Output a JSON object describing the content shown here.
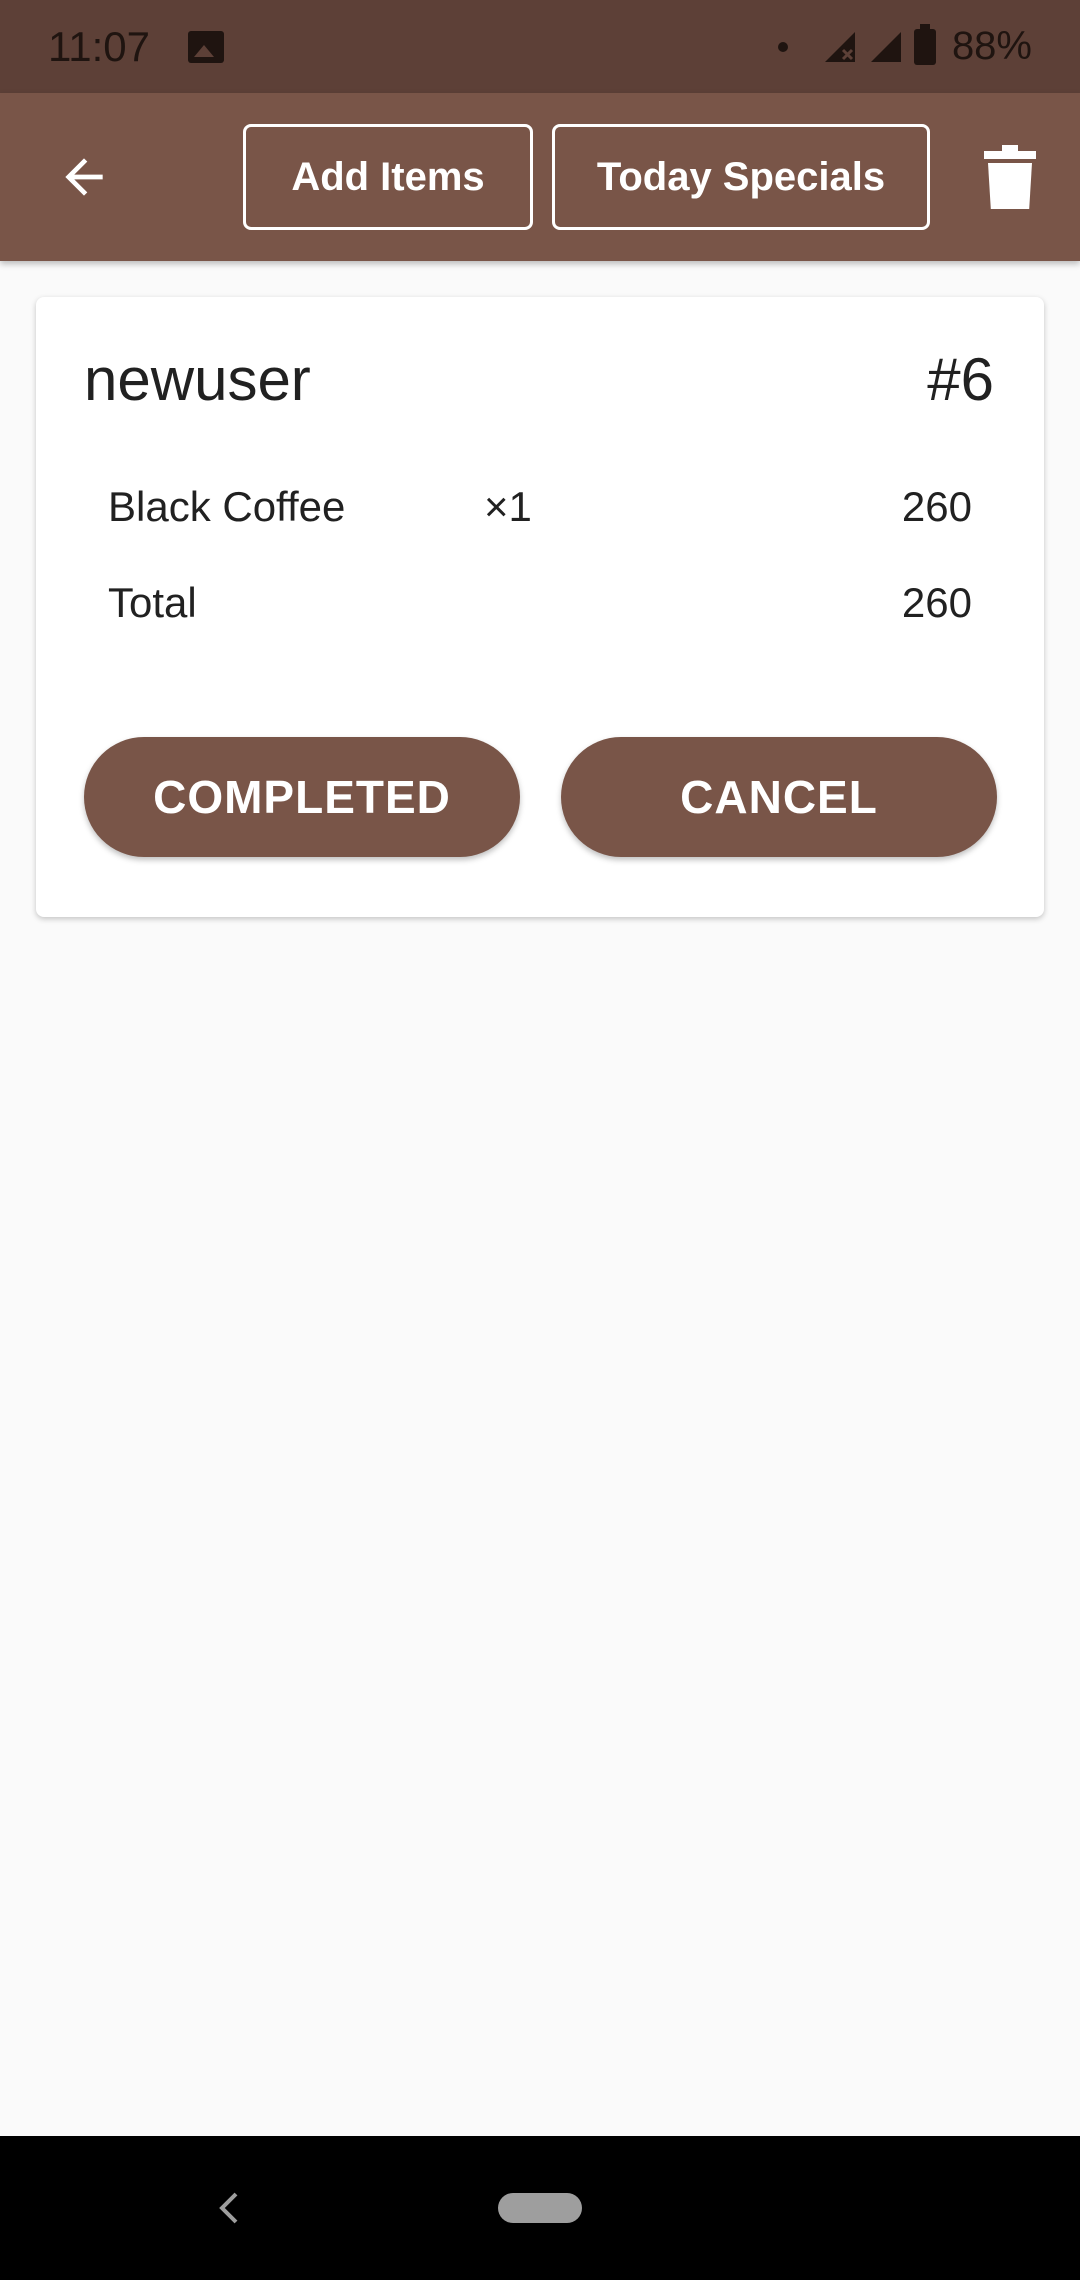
{
  "status_bar": {
    "time": "11:07",
    "battery": "88%",
    "icons": [
      "gallery-icon",
      "notification-dot-icon",
      "signal-no-data-icon",
      "signal-icon",
      "battery-icon"
    ]
  },
  "app_bar": {
    "back_icon": "arrow-left-icon",
    "add_items_label": "Add Items",
    "today_specials_label": "Today Specials",
    "delete_icon": "trash-icon"
  },
  "order": {
    "user": "newuser",
    "order_number": "#6",
    "items": [
      {
        "name": "Black Coffee",
        "qty": "×1",
        "price": "260"
      }
    ],
    "total_label": "Total",
    "total_value": "260",
    "completed_label": "COMPLETED",
    "cancel_label": "CANCEL"
  },
  "colors": {
    "status_bar": "#5d4037",
    "primary": "#795548",
    "background": "#fafafa",
    "card": "#ffffff"
  }
}
